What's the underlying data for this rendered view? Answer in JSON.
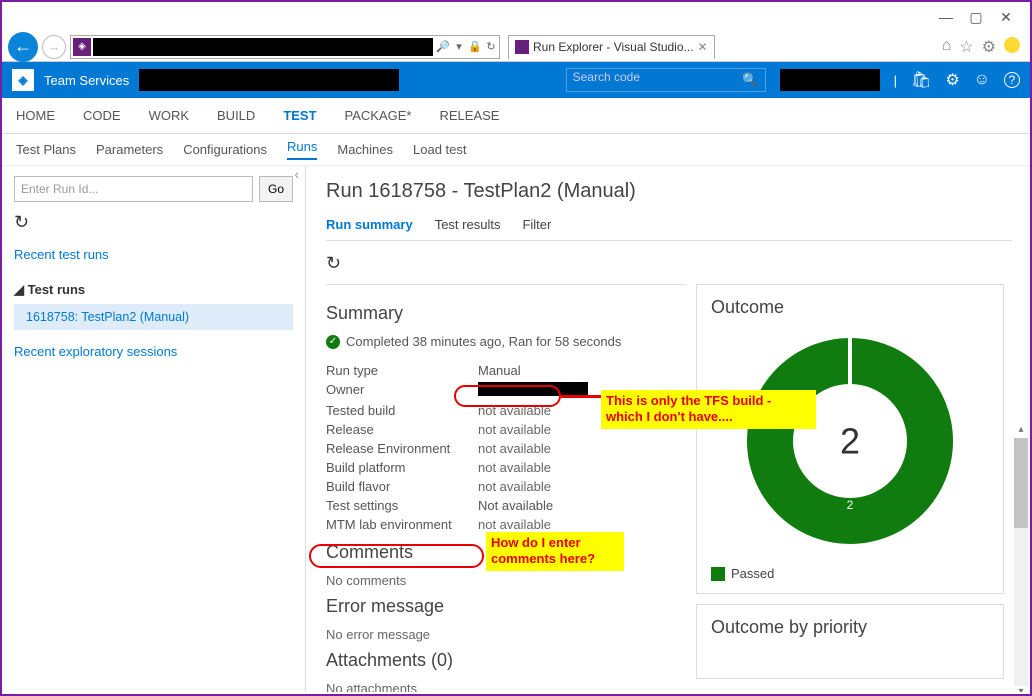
{
  "window": {
    "minimize": "—",
    "maximize": "▢",
    "close": "✕"
  },
  "browser": {
    "tab_title": "Run Explorer - Visual Studio...",
    "icons": {
      "home": "⌂",
      "star": "☆",
      "gear": "⚙"
    }
  },
  "header": {
    "product": "Team Services",
    "search_placeholder": "Search code",
    "icons": {
      "shop": "🛍",
      "gear": "⚙",
      "smiley": "☺",
      "help": "?"
    }
  },
  "nav1": {
    "home": "HOME",
    "code": "CODE",
    "work": "WORK",
    "build": "BUILD",
    "test": "TEST",
    "package": "PACKAGE*",
    "release": "RELEASE"
  },
  "nav2": {
    "plans": "Test Plans",
    "params": "Parameters",
    "config": "Configurations",
    "runs": "Runs",
    "machines": "Machines",
    "load": "Load test"
  },
  "side": {
    "placeholder": "Enter Run Id...",
    "go": "Go",
    "recent_runs": "Recent test runs",
    "test_runs_header": "Test runs",
    "item": "1618758: TestPlan2 (Manual)",
    "recent_expl": "Recent exploratory sessions"
  },
  "main": {
    "title": "Run 1618758 - TestPlan2 (Manual)",
    "tabs": {
      "summary": "Run summary",
      "results": "Test results",
      "filter": "Filter"
    }
  },
  "summary": {
    "heading": "Summary",
    "status": "Completed 38 minutes ago, Ran for 58 seconds",
    "rows": {
      "run_type_k": "Run type",
      "run_type_v": "Manual",
      "owner_k": "Owner",
      "tested_build_k": "Tested build",
      "tested_build_v": "not available",
      "release_k": "Release",
      "release_v": "not available",
      "release_env_k": "Release Environment",
      "release_env_v": "not available",
      "build_platform_k": "Build platform",
      "build_platform_v": "not available",
      "build_flavor_k": "Build flavor",
      "build_flavor_v": "not available",
      "test_settings_k": "Test settings",
      "test_settings_v": "Not available",
      "mtm_k": "MTM lab environment",
      "mtm_v": "not available"
    }
  },
  "comments": {
    "heading": "Comments",
    "body": "No comments"
  },
  "error": {
    "heading": "Error message",
    "body": "No error message"
  },
  "attachments": {
    "heading": "Attachments (0)",
    "body": "No attachments"
  },
  "outcome": {
    "heading": "Outcome",
    "total": "2",
    "passed_count": "2",
    "legend": "Passed"
  },
  "priority": {
    "heading": "Outcome by priority"
  },
  "annotations": {
    "build_note": "This is only the TFS build - which I don't have....",
    "comments_note": "How do I enter comments here?"
  },
  "chart_data": {
    "type": "pie",
    "title": "Outcome",
    "categories": [
      "Passed"
    ],
    "values": [
      2
    ],
    "series": [
      {
        "name": "Passed",
        "values": [
          2
        ],
        "color": "#107c10"
      }
    ],
    "total": 2
  }
}
